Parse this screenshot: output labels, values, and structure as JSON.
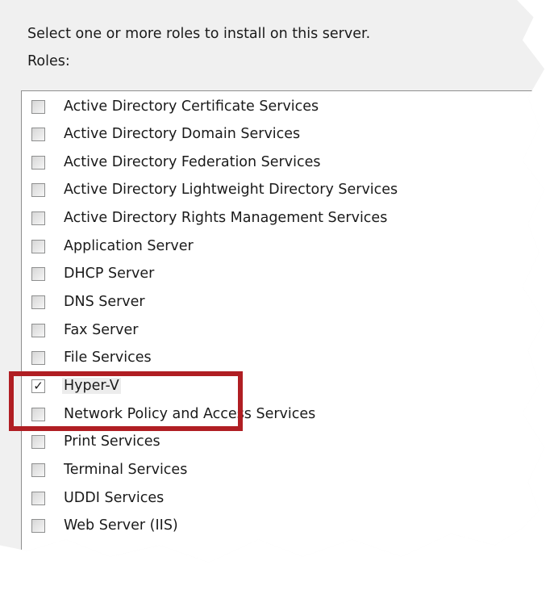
{
  "instruction": "Select one or more roles to install on this server.",
  "roles_label": "Roles:",
  "roles": [
    {
      "label": "Active Directory Certificate Services",
      "checked": false
    },
    {
      "label": "Active Directory Domain Services",
      "checked": false
    },
    {
      "label": "Active Directory Federation Services",
      "checked": false
    },
    {
      "label": "Active Directory Lightweight Directory Services",
      "checked": false
    },
    {
      "label": "Active Directory Rights Management Services",
      "checked": false
    },
    {
      "label": "Application Server",
      "checked": false
    },
    {
      "label": "DHCP Server",
      "checked": false
    },
    {
      "label": "DNS Server",
      "checked": false
    },
    {
      "label": "Fax Server",
      "checked": false
    },
    {
      "label": "File Services",
      "checked": false
    },
    {
      "label": "Hyper-V",
      "checked": true
    },
    {
      "label": "Network Policy and Access Services",
      "checked": false
    },
    {
      "label": "Print Services",
      "checked": false
    },
    {
      "label": "Terminal Services",
      "checked": false
    },
    {
      "label": "UDDI Services",
      "checked": false
    },
    {
      "label": "Web Server (IIS)",
      "checked": false
    }
  ],
  "check_glyph": "✓",
  "highlight_color": "#b01e23"
}
